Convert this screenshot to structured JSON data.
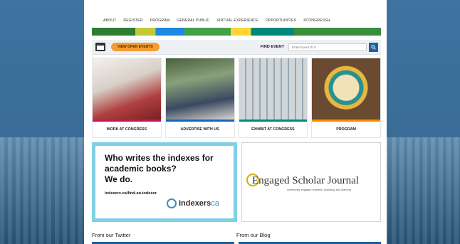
{
  "nav": {
    "items": [
      "ABOUT",
      "REGISTER",
      "PROGRAM",
      "GENERAL PUBLIC",
      "VIRTUAL EXPERIENCE",
      "OPPORTUNITIES",
      "#CONGRESSH"
    ]
  },
  "toolbar": {
    "open_events_label": "VIEW OPEN EVENTS",
    "find_label": "FIND EVENT",
    "find_placeholder": "Enter Event ID #",
    "calendar_icon": "calendar-icon",
    "search_icon": "search-icon"
  },
  "tiles": [
    {
      "label": "WORK AT CONGRESS",
      "accent": "#c2185b"
    },
    {
      "label": "ADVERTISE WITH US",
      "accent": "#1565c0"
    },
    {
      "label": "EXHIBIT AT CONGRESS",
      "accent": "#00897b"
    },
    {
      "label": "PROGRAM",
      "accent": "#fb8c00"
    }
  ],
  "ads": {
    "index": {
      "headline_lines": [
        "Who writes the indexes for",
        "academic books?",
        "We do."
      ],
      "url": "indexers.ca/find-an-indexer",
      "brand": "Indexers",
      "brand_suffix": "ca"
    },
    "journal": {
      "title": "Engaged Scholar Journal",
      "tagline": "community-engaged research, teaching, and learning"
    }
  },
  "sections": {
    "twitter": "From our Twitter",
    "blog": "From our Blog"
  },
  "colors": {
    "accent_orange": "#f39c33",
    "primary_blue": "#1f5f9f",
    "ad_border": "#7fd0e4"
  }
}
